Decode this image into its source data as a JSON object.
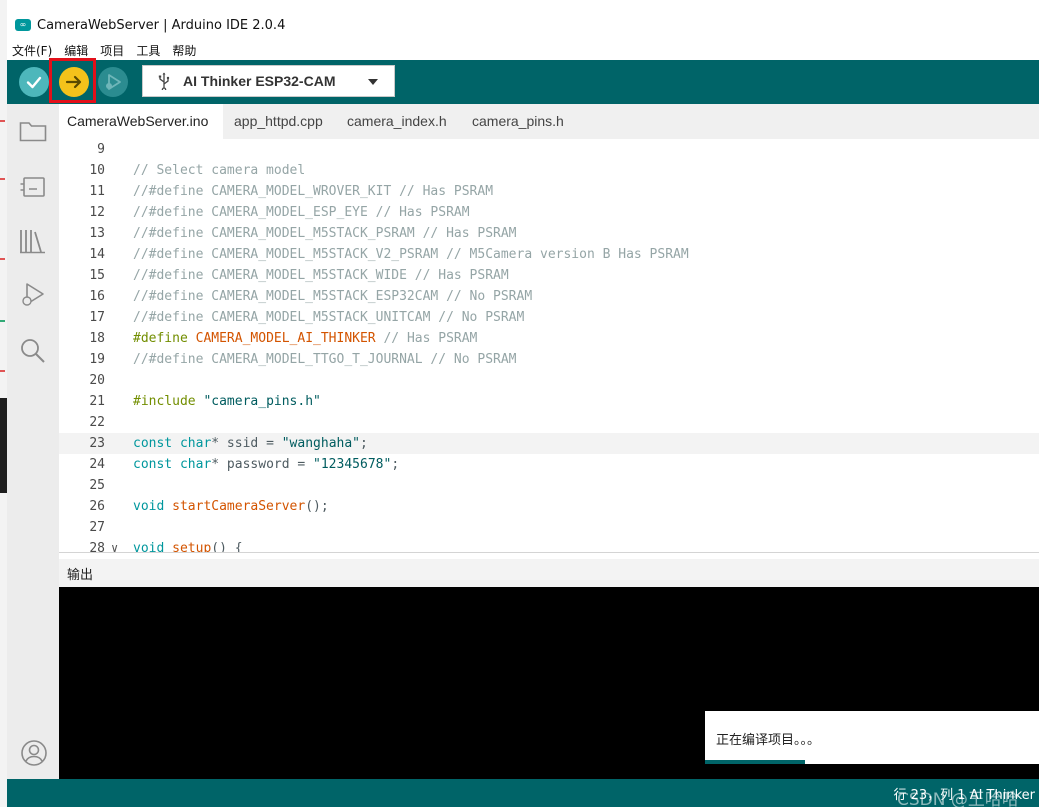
{
  "window": {
    "title": "CameraWebServer | Arduino IDE 2.0.4"
  },
  "menu": [
    "文件(F)",
    "编辑",
    "项目",
    "工具",
    "帮助"
  ],
  "toolbar": {
    "board": "AI Thinker ESP32-CAM"
  },
  "tabs": [
    "CameraWebServer.ino",
    "app_httpd.cpp",
    "camera_index.h",
    "camera_pins.h"
  ],
  "editor": {
    "current_line": 23,
    "lines": [
      {
        "n": "9",
        "text": ""
      },
      {
        "n": "10",
        "text": "// Select camera model"
      },
      {
        "n": "11",
        "text": "//#define CAMERA_MODEL_WROVER_KIT // Has PSRAM"
      },
      {
        "n": "12",
        "text": "//#define CAMERA_MODEL_ESP_EYE // Has PSRAM"
      },
      {
        "n": "13",
        "text": "//#define CAMERA_MODEL_M5STACK_PSRAM // Has PSRAM"
      },
      {
        "n": "14",
        "text": "//#define CAMERA_MODEL_M5STACK_V2_PSRAM // M5Camera version B Has PSRAM"
      },
      {
        "n": "15",
        "text": "//#define CAMERA_MODEL_M5STACK_WIDE // Has PSRAM"
      },
      {
        "n": "16",
        "text": "//#define CAMERA_MODEL_M5STACK_ESP32CAM // No PSRAM"
      },
      {
        "n": "17",
        "text": "//#define CAMERA_MODEL_M5STACK_UNITCAM // No PSRAM"
      },
      {
        "n": "18",
        "text": "#define CAMERA_MODEL_AI_THINKER // Has PSRAM"
      },
      {
        "n": "19",
        "text": "//#define CAMERA_MODEL_TTGO_T_JOURNAL // No PSRAM"
      },
      {
        "n": "20",
        "text": ""
      },
      {
        "n": "21",
        "text": "#include \"camera_pins.h\""
      },
      {
        "n": "22",
        "text": ""
      },
      {
        "n": "23",
        "text": "const char* ssid = \"wanghaha\";"
      },
      {
        "n": "24",
        "text": "const char* password = \"12345678\";"
      },
      {
        "n": "25",
        "text": ""
      },
      {
        "n": "26",
        "text": "void startCameraServer();"
      },
      {
        "n": "27",
        "text": ""
      },
      {
        "n": "28",
        "text": "void setup() {"
      }
    ]
  },
  "output": {
    "label": "输出"
  },
  "notification": {
    "text": "正在编译项目。。。",
    "progress_fraction": 0.3
  },
  "status": {
    "text": "行 23，列 1    AI Thinker"
  },
  "watermark": "CSDN @王哈哈",
  "colors": {
    "teal": "#006468",
    "upload": "#f4c21b",
    "highlight": "#e3101a"
  }
}
